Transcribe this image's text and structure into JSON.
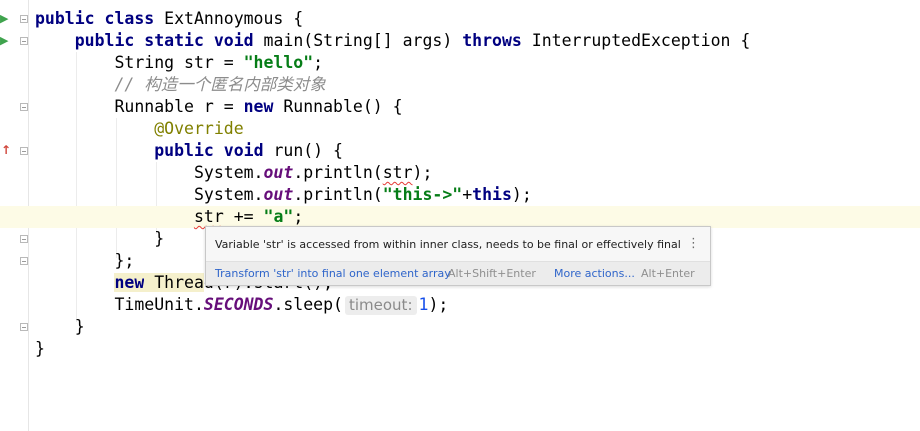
{
  "editor": {
    "lines": {
      "l1": {
        "kw1": "public",
        "kw2": "class",
        "name": " ExtAnnoymous ",
        "brace": "{"
      },
      "l2": {
        "kw1": "public",
        "kw2": "static",
        "kw3": "void",
        "sig": " main(String[] args) ",
        "kw4": "throws",
        "exc": " InterruptedException {"
      },
      "l3": {
        "pre": "String str = ",
        "str": "\"hello\"",
        "post": ";"
      },
      "l4": {
        "comment": "// 构造一个匿名内部类对象"
      },
      "l5": {
        "pre": "Runnable r = ",
        "kw": "new",
        "post": " Runnable() {"
      },
      "l6": {
        "ann": "@Override"
      },
      "l7": {
        "kw1": "public",
        "kw2": "void",
        "post": " run() {"
      },
      "l8": {
        "pre": "System.",
        "field": "out",
        "mid": ".println(",
        "var": "str",
        "post": ");"
      },
      "l9": {
        "pre": "System.",
        "field": "out",
        "mid": ".println(",
        "str": "\"this->\"",
        "plus": "+",
        "kw": "this",
        "post": ");"
      },
      "l10": {
        "var": "str",
        "mid": " += ",
        "str": "\"a\"",
        "post": ";"
      },
      "l11": {
        "brace": "}"
      },
      "l12": {
        "brace": "};"
      },
      "l13": {
        "kw": "new",
        "hl": " Threa",
        "post": "d(r).start();"
      },
      "l14": {
        "pre": "TimeUnit.",
        "field": "SECONDS",
        "mid": ".sleep(",
        "hint": "timeout:",
        "num": "1",
        "post": ");"
      },
      "l15": {
        "brace": "}"
      },
      "l16": {
        "brace": "}"
      }
    }
  },
  "popup": {
    "message": "Variable 'str' is accessed from within inner class, needs to be final or effectively final",
    "more_icon": "⋮",
    "action_label": "Transform 'str' into final one element array",
    "action_shortcut": "Alt+Shift+Enter",
    "more_label": "More actions...",
    "more_shortcut": "Alt+Enter"
  },
  "icons": {
    "run": "▶",
    "override": "↑"
  }
}
